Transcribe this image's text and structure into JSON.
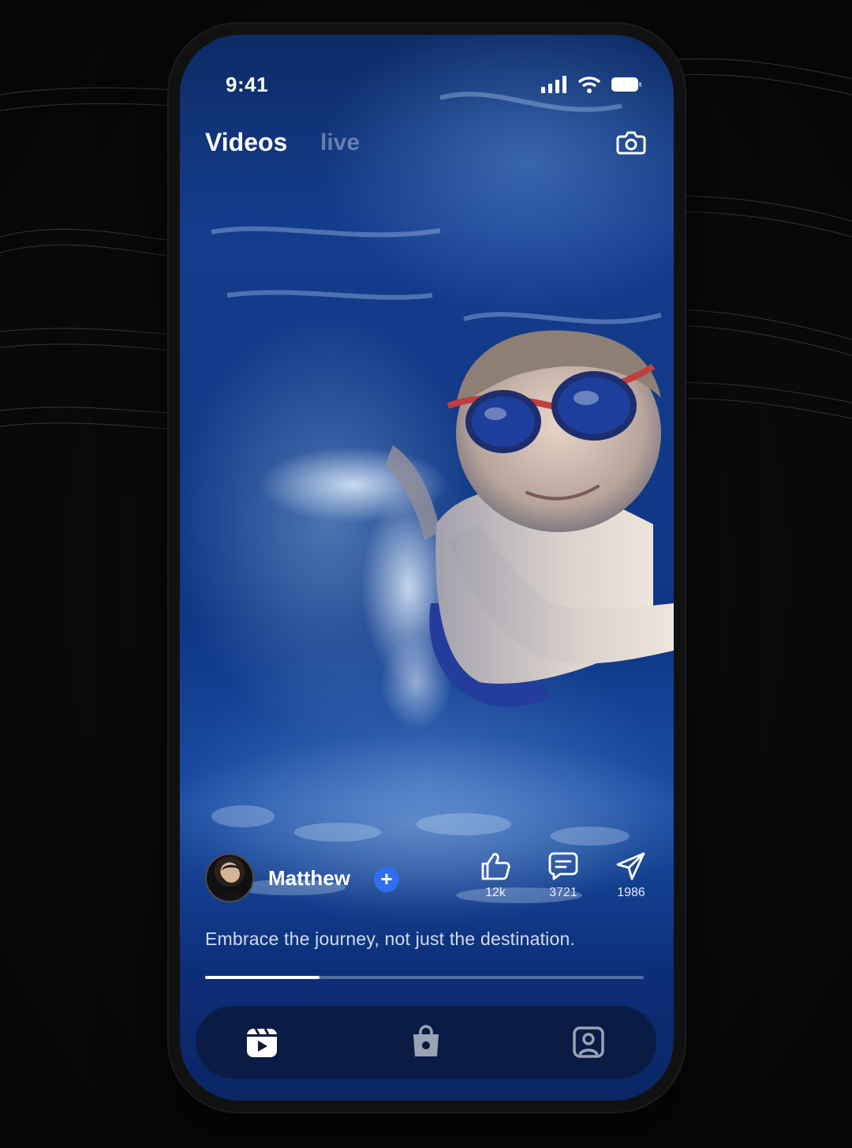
{
  "status_bar": {
    "time": "9:41"
  },
  "header": {
    "tabs": [
      {
        "label": "Videos",
        "active": true
      },
      {
        "label": "live",
        "active": false
      }
    ],
    "camera_icon": "camera-icon"
  },
  "post": {
    "author": {
      "name": "Matthew",
      "follow_icon": "plus-icon"
    },
    "caption": "Embrace the journey, not just the destination.",
    "actions": [
      {
        "icon": "thumbs-up-icon",
        "count": "12k"
      },
      {
        "icon": "comment-icon",
        "count": "3721"
      },
      {
        "icon": "send-icon",
        "count": "1986"
      }
    ],
    "progress": 0.26
  },
  "bottom_nav": {
    "items": [
      {
        "icon": "video-play-icon",
        "active": true
      },
      {
        "icon": "shopping-bag-icon",
        "active": false
      },
      {
        "icon": "profile-icon",
        "active": false
      }
    ]
  },
  "colors": {
    "accent": "#2f6ff0",
    "water_dark": "#0a2664",
    "water_mid": "#143c8c",
    "nav_bg": "#0a1a3c"
  }
}
